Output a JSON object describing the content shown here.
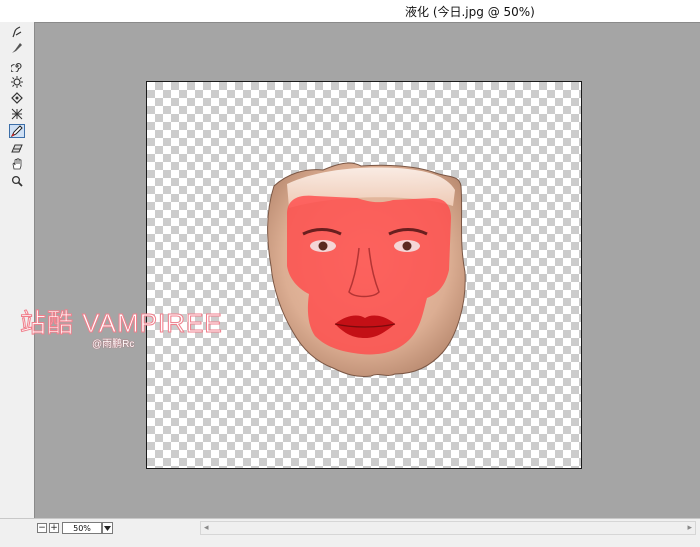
{
  "window": {
    "title": "液化 (今日.jpg @ 50%)"
  },
  "tools": [
    {
      "name": "forward-warp-tool",
      "icon": "warp-icon",
      "active": false
    },
    {
      "name": "reconstruct-tool",
      "icon": "brush-icon",
      "active": false
    },
    {
      "name": "twirl-clockwise-tool",
      "icon": "twirl-icon",
      "active": false
    },
    {
      "name": "pucker-tool",
      "icon": "pucker-icon",
      "active": false
    },
    {
      "name": "bloat-tool",
      "icon": "bloat-icon",
      "active": false
    },
    {
      "name": "push-left-tool",
      "icon": "push-left-icon",
      "active": false
    },
    {
      "name": "freeze-mask-tool",
      "icon": "freeze-mask-icon",
      "active": true
    },
    {
      "name": "thaw-mask-tool",
      "icon": "thaw-mask-icon",
      "active": false
    },
    {
      "name": "hand-tool",
      "icon": "hand-icon",
      "active": false
    },
    {
      "name": "zoom-tool",
      "icon": "magnifier-icon",
      "active": false
    }
  ],
  "watermark": {
    "main": "站酷 VAMPIREE",
    "sub": "@雨鹏Rc"
  },
  "status": {
    "zoom_out": "−",
    "zoom_in": "+",
    "zoom_value": "50%"
  },
  "colors": {
    "mask": "#ff4c4c",
    "canvas_bg": "#a5a5a5",
    "active_tool": "#cfe0f5"
  }
}
